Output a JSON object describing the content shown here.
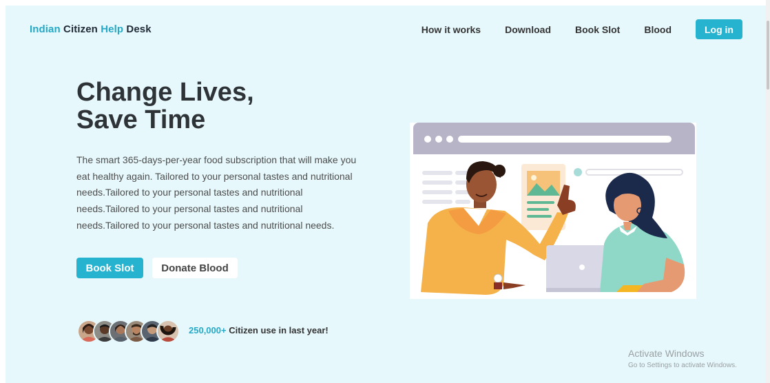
{
  "brand": {
    "part1": "Indian",
    "part2": "Citizen",
    "part3": "Help",
    "part4": "Desk"
  },
  "nav": {
    "items": [
      "How it works",
      "Download",
      "Book Slot",
      "Blood"
    ],
    "login_label": "Log in"
  },
  "hero": {
    "title_line1": "Change Lives,",
    "title_line2": "Save Time",
    "description": "The smart 365-days-per-year food subscription that will make you eat healthy again. Tailored to your personal tastes and nutritional needs.Tailored to your personal tastes and nutritional needs.Tailored to your personal tastes and nutritional needs.Tailored to your personal tastes and nutritional needs.",
    "primary_button": "Book Slot",
    "secondary_button": "Donate Blood"
  },
  "social_proof": {
    "count": "250,000+",
    "text": "Citizen use in last year!"
  },
  "colors": {
    "accent": "#26b3cf",
    "background": "#e6f8fc"
  },
  "watermark": {
    "title": "Activate Windows",
    "subtitle": "Go to Settings to activate Windows."
  }
}
